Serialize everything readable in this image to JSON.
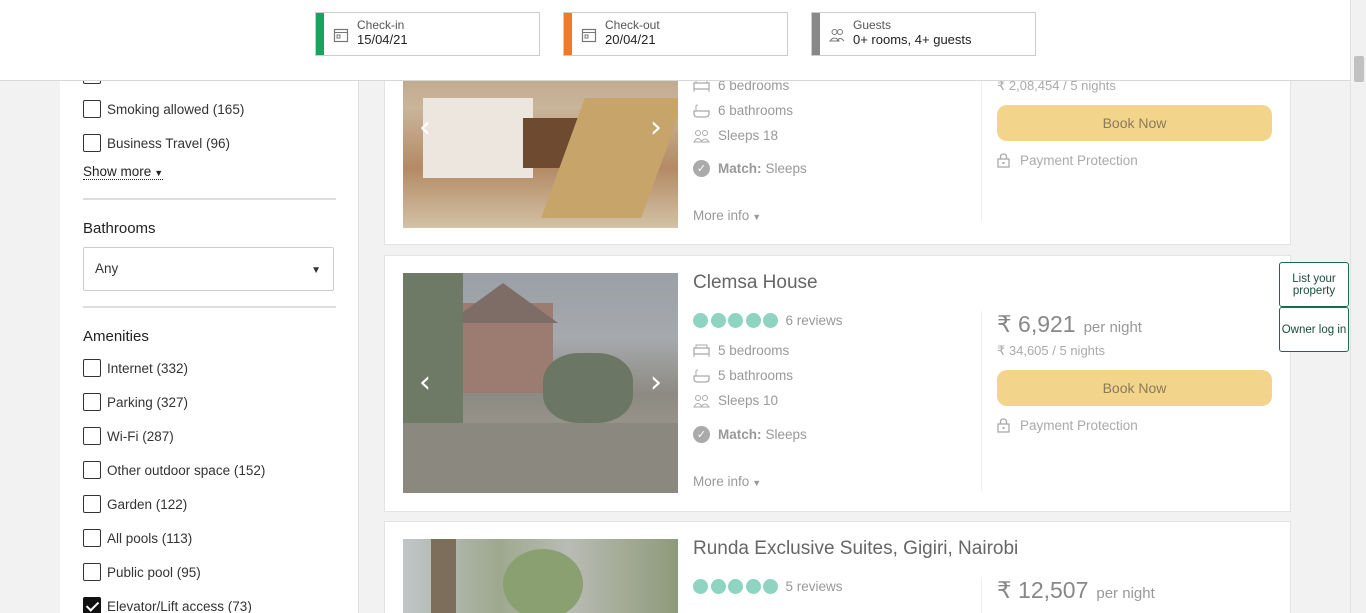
{
  "header": {
    "checkin": {
      "label": "Check-in",
      "value": "15/04/21",
      "color": "#1aa35f"
    },
    "checkout": {
      "label": "Check-out",
      "value": "20/04/21",
      "color": "#f07a2a"
    },
    "guests": {
      "label": "Guests",
      "value": "0+ rooms, 4+ guests",
      "color": "#888888"
    }
  },
  "sidebar": {
    "filters_top": [
      {
        "label": "Smoking allowed (165)",
        "checked": false
      },
      {
        "label": "Business Travel (96)",
        "checked": false
      }
    ],
    "show_more": "Show more",
    "bathrooms": {
      "title": "Bathrooms",
      "value": "Any"
    },
    "amenities": {
      "title": "Amenities",
      "items": [
        {
          "label": "Internet (332)",
          "checked": false
        },
        {
          "label": "Parking (327)",
          "checked": false
        },
        {
          "label": "Wi-Fi (287)",
          "checked": false
        },
        {
          "label": "Other outdoor space (152)",
          "checked": false
        },
        {
          "label": "Garden (122)",
          "checked": false
        },
        {
          "label": "All pools (113)",
          "checked": false
        },
        {
          "label": "Public pool (95)",
          "checked": false
        },
        {
          "label": "Elevator/Lift access (73)",
          "checked": true
        }
      ]
    }
  },
  "listings": [
    {
      "name": "",
      "bedrooms": "6 bedrooms",
      "bathrooms": "6 bathrooms",
      "sleeps": "Sleeps 18",
      "match_label": "Match:",
      "match_value": "Sleeps",
      "more_info": "More info",
      "total": "₹ 2,08,454 / 5 nights",
      "book": "Book Now",
      "protection": "Payment Protection"
    },
    {
      "name": "Clemsa House",
      "rating": 5,
      "reviews": "6 reviews",
      "bedrooms": "5 bedrooms",
      "bathrooms": "5 bathrooms",
      "sleeps": "Sleeps 10",
      "match_label": "Match:",
      "match_value": "Sleeps",
      "more_info": "More info",
      "price": "₹ 6,921",
      "per_night": "per night",
      "total": "₹ 34,605 / 5 nights",
      "book": "Book Now",
      "protection": "Payment Protection"
    },
    {
      "name": "Runda Exclusive Suites, Gigiri, Nairobi",
      "rating": 5,
      "reviews": "5 reviews",
      "price": "₹ 12,507",
      "per_night": "per night"
    }
  ],
  "side_buttons": {
    "list_property": "List your property",
    "owner_login": "Owner log in"
  }
}
